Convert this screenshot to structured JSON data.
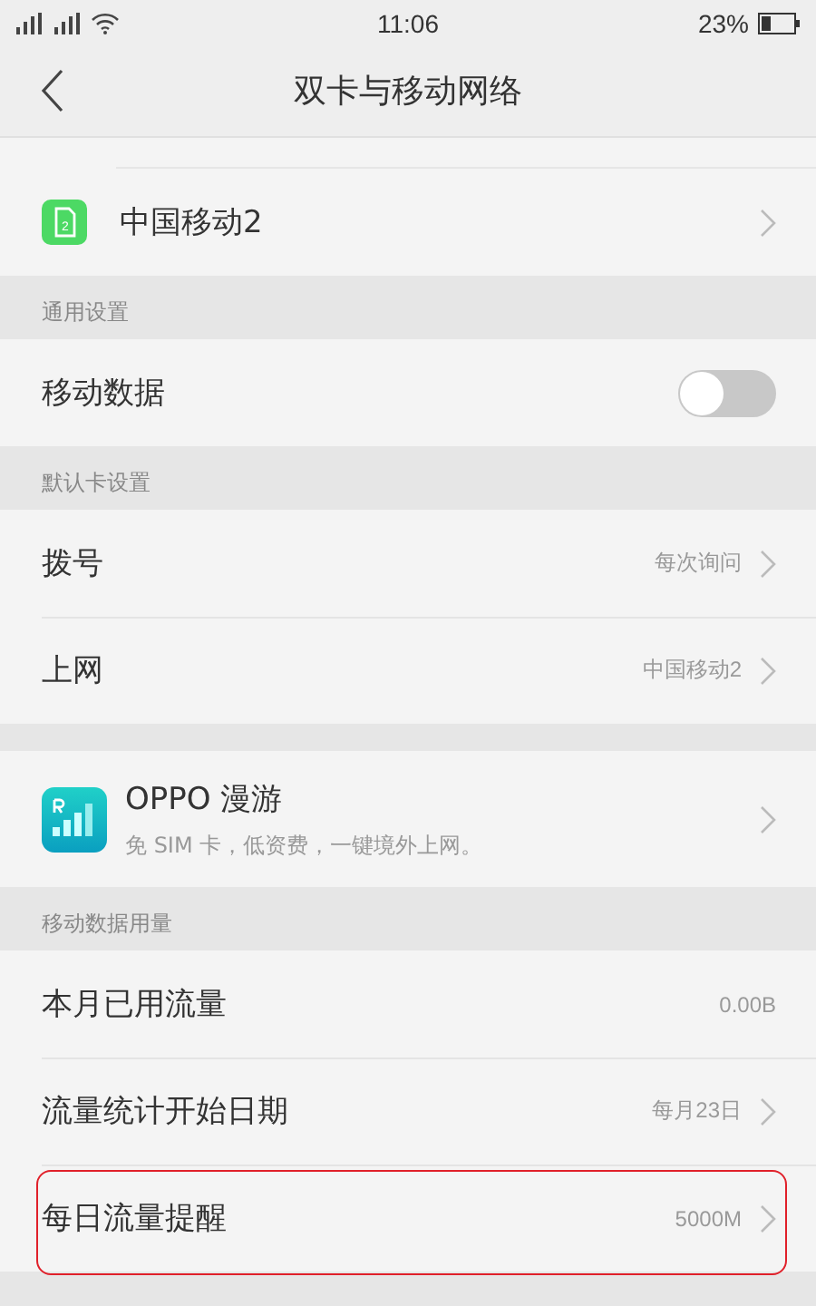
{
  "status_bar": {
    "time": "11:06",
    "battery": "23%"
  },
  "header": {
    "title": "双卡与移动网络"
  },
  "blocks": [
    {
      "kind": "group",
      "rows": [
        {
          "kind": "sim",
          "label": "中国移动2",
          "sim_number": "2"
        }
      ]
    },
    {
      "kind": "section",
      "title": "通用设置"
    },
    {
      "kind": "group",
      "rows": [
        {
          "kind": "toggle",
          "label": "移动数据",
          "on": false
        }
      ]
    },
    {
      "kind": "section",
      "title": "默认卡设置"
    },
    {
      "kind": "group",
      "rows": [
        {
          "kind": "nav",
          "label": "拨号",
          "value": "每次询问"
        },
        {
          "kind": "nav",
          "label": "上网",
          "value": "中国移动2"
        }
      ]
    },
    {
      "kind": "spacer"
    },
    {
      "kind": "group",
      "rows": [
        {
          "kind": "promo",
          "label": "OPPO 漫游",
          "subtitle": "免 SIM 卡，低资费，一键境外上网。"
        }
      ]
    },
    {
      "kind": "section",
      "title": "移动数据用量"
    },
    {
      "kind": "group",
      "rows": [
        {
          "kind": "value",
          "label": "本月已用流量",
          "value": "0.00B"
        },
        {
          "kind": "nav",
          "label": "流量统计开始日期",
          "value": "每月23日"
        },
        {
          "kind": "nav",
          "label": "每日流量提醒",
          "value": "5000M",
          "highlighted": true
        }
      ]
    }
  ]
}
